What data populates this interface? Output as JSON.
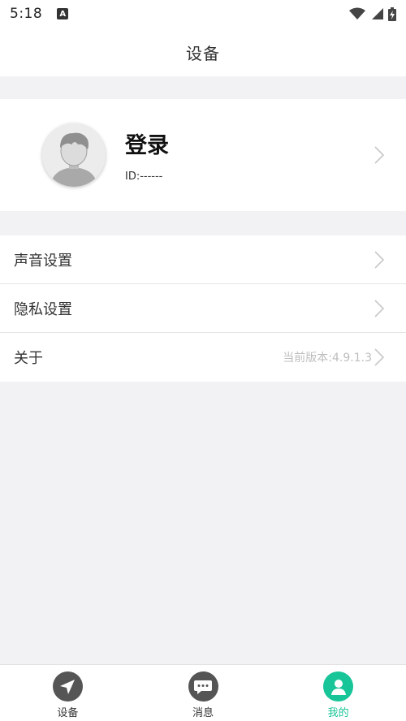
{
  "status_bar": {
    "time": "5:18",
    "app_badge": "A"
  },
  "header": {
    "title": "设备"
  },
  "profile": {
    "login_label": "登录",
    "id_label": "ID:------"
  },
  "menu": [
    {
      "label": "声音设置",
      "value": ""
    },
    {
      "label": "隐私设置",
      "value": ""
    },
    {
      "label": "关于",
      "value": "当前版本:4.9.1.3"
    }
  ],
  "tabs": [
    {
      "label": "设备",
      "icon": "send-icon",
      "active": false
    },
    {
      "label": "消息",
      "icon": "chat-bubble-icon",
      "active": false
    },
    {
      "label": "我的",
      "icon": "person-icon",
      "active": true
    }
  ],
  "colors": {
    "accent": "#18c598",
    "inactive_icon": "#555555",
    "background": "#f2f2f4"
  }
}
